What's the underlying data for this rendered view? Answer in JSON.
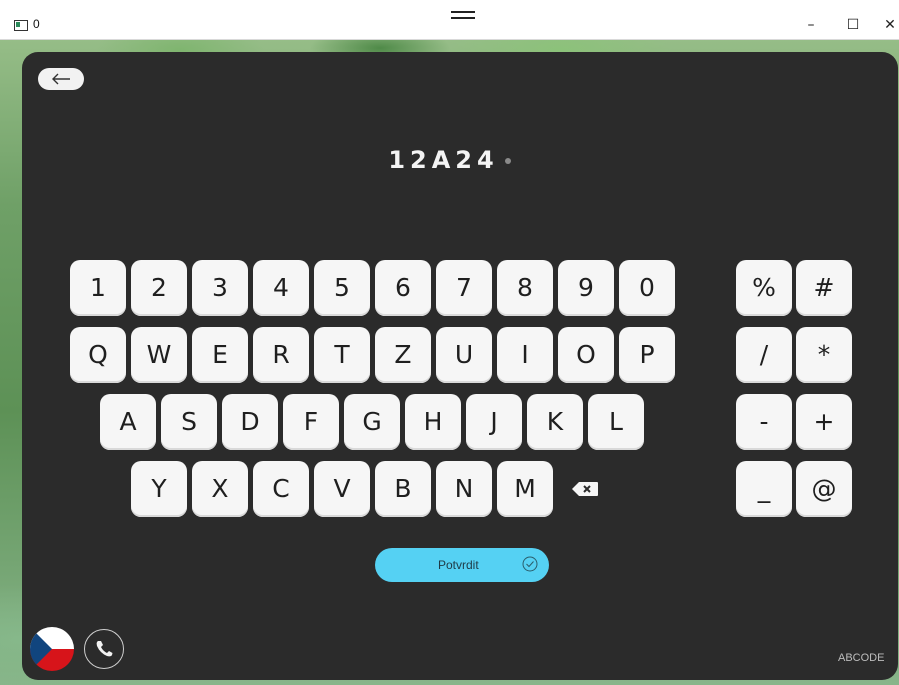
{
  "window": {
    "title": "0",
    "minimize_glyph": "–",
    "maximize_glyph": "☐",
    "close_glyph": "✕"
  },
  "code_entry": {
    "value": "12A24"
  },
  "keyboard": {
    "row1": [
      "1",
      "2",
      "3",
      "4",
      "5",
      "6",
      "7",
      "8",
      "9",
      "0"
    ],
    "row2": [
      "Q",
      "W",
      "E",
      "R",
      "T",
      "Z",
      "U",
      "I",
      "O",
      "P"
    ],
    "row3": [
      "A",
      "S",
      "D",
      "F",
      "G",
      "H",
      "J",
      "K",
      "L"
    ],
    "row4": [
      "Y",
      "X",
      "C",
      "V",
      "B",
      "N",
      "M"
    ],
    "symbols": [
      "%",
      "#",
      "/",
      "*",
      "-",
      "+",
      "_",
      "@"
    ]
  },
  "confirm_button": {
    "label": "Potvrdit"
  },
  "footer": {
    "brand": "ABCODE"
  },
  "icons": {
    "back": "arrow-left-icon",
    "backspace": "backspace-icon",
    "check": "check-circle-icon",
    "flag": "czech-flag-icon",
    "phone": "phone-icon"
  },
  "colors": {
    "panel": "#2b2b2b",
    "key": "#f6f6f6",
    "confirm": "#55d1f3"
  }
}
